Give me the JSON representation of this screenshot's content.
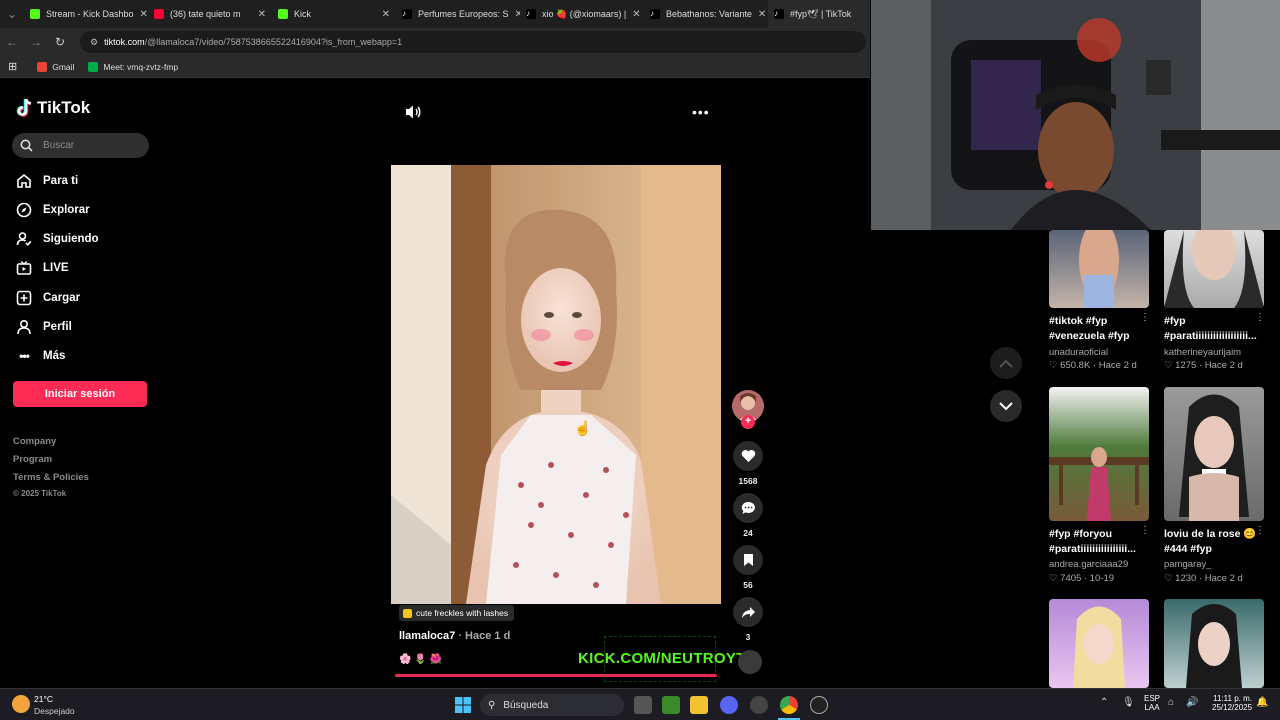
{
  "browser": {
    "tabs": [
      {
        "label": "Stream - Kick Dashbo",
        "color": "#53fc18"
      },
      {
        "label": "(36) tate quieto m",
        "color": "#ff0033"
      },
      {
        "label": "Kick",
        "color": "#53fc18"
      },
      {
        "label": "Perfumes Europeos: S",
        "color": "#ffffff"
      },
      {
        "label": "xio 🍓 (@xiomaars) |",
        "color": "#ffffff"
      },
      {
        "label": "Bebathanos: Variante",
        "color": "#ffffff"
      },
      {
        "label": "#fyp🕊 | TikTok",
        "color": "#ffffff"
      }
    ],
    "url_host": "tiktok.com",
    "url_path": "/@llamaloca7/video/7587538665522416904?is_from_webapp=1",
    "bookmarks": [
      {
        "label": "Gmail",
        "color": "#ea4335"
      },
      {
        "label": "Meet: vmq-zvtz-fmp",
        "color": "#00ac47"
      }
    ]
  },
  "sidebar": {
    "logo": "TikTok",
    "search_placeholder": "Buscar",
    "nav": [
      {
        "label": "Para ti",
        "icon": "home-icon"
      },
      {
        "label": "Explorar",
        "icon": "compass-icon"
      },
      {
        "label": "Siguiendo",
        "icon": "following-icon"
      },
      {
        "label": "LIVE",
        "icon": "live-icon"
      },
      {
        "label": "Cargar",
        "icon": "upload-icon"
      },
      {
        "label": "Perfil",
        "icon": "profile-icon"
      },
      {
        "label": "Más",
        "icon": "more-icon"
      }
    ],
    "login_label": "Iniciar sesión",
    "footer": [
      "Company",
      "Program",
      "Terms & Policies"
    ],
    "copyright": "© 2025 TikTok"
  },
  "video": {
    "caption_tag": "cute freckles with lashes",
    "author": "llamaloca7",
    "age": "· Hace 1 d",
    "emojis": "🌸 🌷 🌺",
    "likes": "1568",
    "comments": "24",
    "saves": "56",
    "shares": "3",
    "progress": 0.99
  },
  "overlay": {
    "kick_text": "KICK.COM/NEUTROYT"
  },
  "recommended": [
    {
      "title": "#tiktok #fyp #venezuela #fyp",
      "user": "unaduraoficial",
      "likes": "650.8K",
      "age": "Hace 2 d"
    },
    {
      "title": "#fyp #paratiiiiiiiiiiiiiiiiii...",
      "user": "katherineyaurijaim",
      "likes": "1275",
      "age": "Hace 2 d"
    },
    {
      "title": "#fyp #foryou #paratiiiiiiiiiiiiiiii...",
      "user": "andrea.garciaaa29",
      "likes": "7405",
      "age": "10-19"
    },
    {
      "title": "loviu de la rose 😊 #444 #fyp",
      "user": "pamgaray_",
      "likes": "1230",
      "age": "Hace 2 d"
    }
  ],
  "taskbar": {
    "weather_temp": "21°C",
    "weather_desc": "Despejado",
    "search": "Búsqueda",
    "lang": "ESP",
    "lang2": "LAA",
    "time": "11:11 p. m.",
    "date": "25/12/2025"
  }
}
